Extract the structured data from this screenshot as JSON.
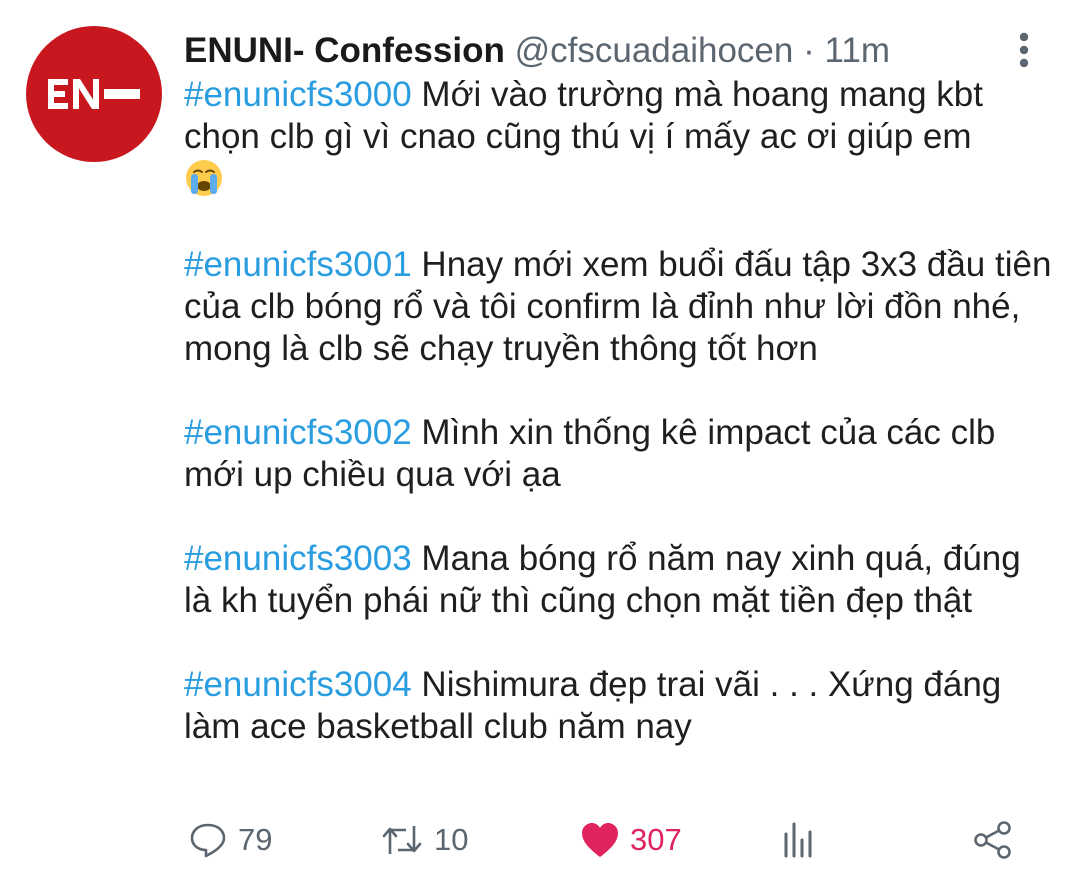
{
  "tweet": {
    "avatar_text": "EN-",
    "display_name": "ENUNI- Confession",
    "handle": "@cfscuadaihocen",
    "separator": "·",
    "time": "11m",
    "entries": [
      {
        "hashtag": "#enunicfs3000",
        "text": " Mới vào trường mà hoang mang kbt chọn clb gì vì cnao cũng thú vị í mấy ac ơi giúp em ",
        "emoji": "loudly-crying-face"
      },
      {
        "hashtag": "#enunicfs3001",
        "text": " Hnay mới xem buổi đấu tập 3x3 đầu tiên của clb bóng rổ và tôi confirm là đỉnh như lời đồn nhé, mong là clb sẽ chạy truyền thông tốt hơn"
      },
      {
        "hashtag": "#enunicfs3002",
        "text": " Mình xin thống kê impact của các clb mới up chiều qua với ạa"
      },
      {
        "hashtag": "#enunicfs3003",
        "text": " Mana bóng rổ năm nay xinh quá, đúng là kh tuyển phái nữ thì cũng chọn mặt tiền đẹp thật"
      },
      {
        "hashtag": "#enunicfs3004",
        "text": " Nishimura đẹp trai vãi . . . Xứng đáng làm ace basketball club năm nay"
      }
    ],
    "actions": {
      "reply_count": "79",
      "retweet_count": "10",
      "like_count": "307"
    },
    "icons": {
      "reply": "reply-icon",
      "retweet": "retweet-icon",
      "like": "heart-icon",
      "analytics": "analytics-icon",
      "share": "share-icon",
      "more": "more-vertical-icon"
    },
    "colors": {
      "avatar_bg": "#c8171e",
      "hashtag": "#2a9de0",
      "like": "#e0245e",
      "muted": "#5b6670"
    }
  }
}
